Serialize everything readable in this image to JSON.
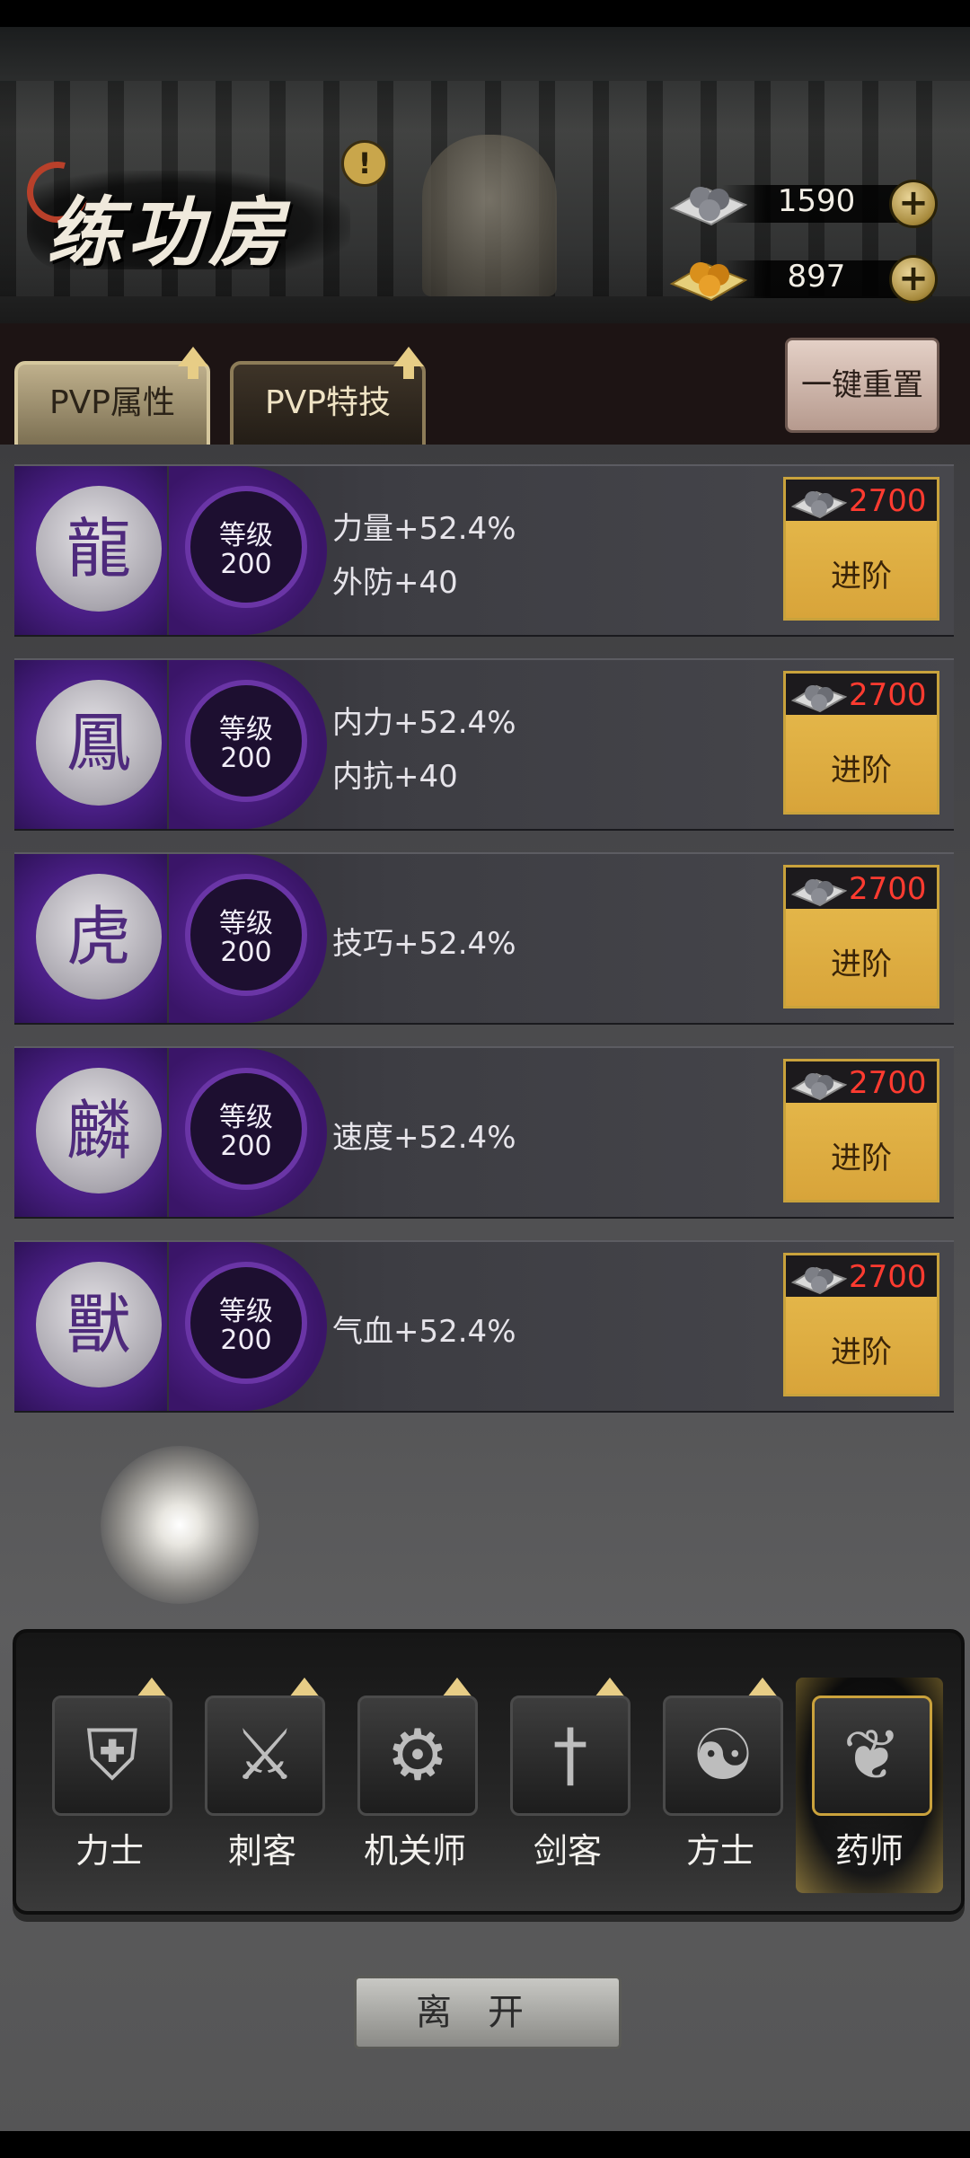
{
  "header": {
    "title": "练功房",
    "notice_glyph": "!",
    "currencies": [
      {
        "icon": "silver-orbs-icon",
        "value": "1590"
      },
      {
        "icon": "gold-orbs-icon",
        "value": "897"
      }
    ],
    "plus_label": "+"
  },
  "tabs": [
    {
      "label": "PVP属性",
      "active": true
    },
    {
      "label": "PVP特技",
      "active": false
    }
  ],
  "reset_button": "一键重置",
  "attributes": [
    {
      "emblem": "dragon-icon",
      "level_label": "等级",
      "level": "200",
      "stats": [
        "力量+52.4%",
        "外防+40"
      ],
      "cost": "2700",
      "action": "进阶"
    },
    {
      "emblem": "phoenix-icon",
      "level_label": "等级",
      "level": "200",
      "stats": [
        "内力+52.4%",
        "内抗+40"
      ],
      "cost": "2700",
      "action": "进阶"
    },
    {
      "emblem": "tiger-icon",
      "level_label": "等级",
      "level": "200",
      "stats": [
        "技巧+52.4%"
      ],
      "cost": "2700",
      "action": "进阶"
    },
    {
      "emblem": "qilin-icon",
      "level_label": "等级",
      "level": "200",
      "stats": [
        "速度+52.4%"
      ],
      "cost": "2700",
      "action": "进阶"
    },
    {
      "emblem": "beast-icon",
      "level_label": "等级",
      "level": "200",
      "stats": [
        "气血+52.4%"
      ],
      "cost": "2700",
      "action": "进阶"
    }
  ],
  "classes": [
    {
      "name": "力士",
      "icon": "shield-icon",
      "active": false
    },
    {
      "name": "刺客",
      "icon": "claw-blade-icon",
      "active": false
    },
    {
      "name": "机关师",
      "icon": "gear-icon",
      "active": false
    },
    {
      "name": "剑客",
      "icon": "sword-icon",
      "active": false
    },
    {
      "name": "方士",
      "icon": "yin-yang-icon",
      "active": false
    },
    {
      "name": "药师",
      "icon": "herb-gourd-icon",
      "active": true
    }
  ],
  "leave_button": "离开",
  "colors": {
    "accent_gold": "#d8a43a",
    "purple": "#4a1f86",
    "cost_red": "#ff3b30"
  }
}
